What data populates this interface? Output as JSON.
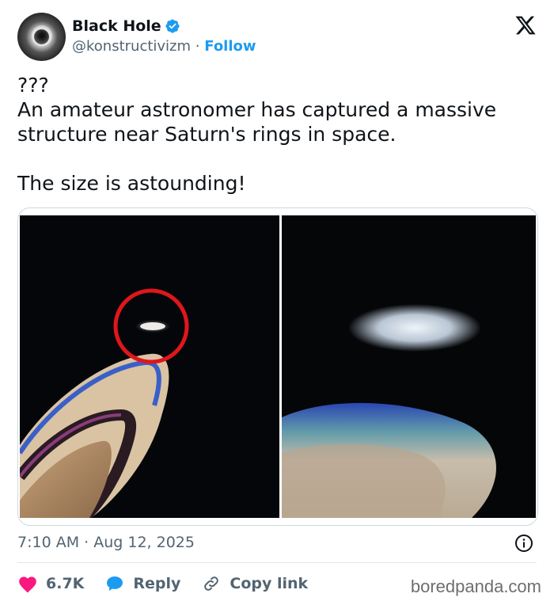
{
  "author": {
    "display_name": "Black Hole",
    "handle": "@konstructivizm",
    "separator": "·",
    "follow_label": "Follow",
    "verified": true
  },
  "tweet": {
    "text": "???\nAn amateur astronomer has captured a massive structure near Saturn's rings in space.\n\nThe size is astounding!",
    "timestamp": "7:10 AM · Aug 12, 2025"
  },
  "media": {
    "count": 2
  },
  "actions": {
    "like_count": "6.7K",
    "reply_label": "Reply",
    "copy_link_label": "Copy link"
  },
  "watermark": "boredpanda.com",
  "colors": {
    "accent": "#1d9bf0",
    "like": "#f91880",
    "muted": "#536471",
    "highlight_circle": "#e0161b"
  },
  "icons": {
    "platform": "x-logo-icon",
    "verified": "verified-badge-icon",
    "info": "info-icon",
    "like": "heart-icon",
    "reply": "reply-bubble-icon",
    "copy_link": "link-icon"
  }
}
